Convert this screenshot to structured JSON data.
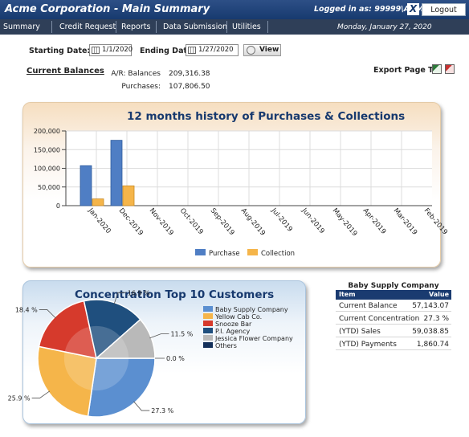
{
  "header": {
    "title": "Acme Corporation - Main Summary",
    "login_text": "Logged in as: 99999\\ADMIN",
    "close_glyph": "X",
    "logout_label": "Logout"
  },
  "menu": {
    "items": [
      "Summary",
      "Credit Request",
      "Reports",
      "Data Submission",
      "Utilities"
    ],
    "date_text": "Monday, January 27, 2020"
  },
  "filters": {
    "starting_label": "Starting Date:",
    "starting_value": "1/1/2020",
    "ending_label": "Ending Date:",
    "ending_value": "1/27/2020",
    "view_label": "View"
  },
  "balances": {
    "title": "Current Balances",
    "ar_label": "A/R: Balances",
    "ar_value": "209,316.38",
    "purchases_label": "Purchases:",
    "purchases_value": "107,806.50"
  },
  "export": {
    "label": "Export Page To:",
    "icons": [
      "excel-icon",
      "pdf-icon"
    ]
  },
  "colors": {
    "purchase": "#4f7ec4",
    "collection": "#f5b54a",
    "header_blue": "#17396e"
  },
  "chart_data": [
    {
      "type": "bar",
      "title": "12 months history of Purchases & Collections",
      "categories": [
        "Jan-2020",
        "Dec-2019",
        "Nov-2019",
        "Oct-2019",
        "Sep-2019",
        "Aug-2019",
        "Jul-2019",
        "Jun-2019",
        "May-2019",
        "Apr-2019",
        "Mar-2019",
        "Feb-2019"
      ],
      "series": [
        {
          "name": "Purchase",
          "values": [
            107000,
            175000,
            0,
            0,
            0,
            0,
            0,
            0,
            0,
            0,
            0,
            0
          ]
        },
        {
          "name": "Collection",
          "values": [
            18000,
            53000,
            0,
            0,
            0,
            0,
            0,
            0,
            0,
            0,
            0,
            0
          ]
        }
      ],
      "ylim": [
        0,
        200000
      ],
      "yticks": [
        "200,000",
        "150,000",
        "100,000",
        "50,000",
        "0"
      ],
      "grid": true,
      "legend": "bottom"
    },
    {
      "type": "pie",
      "title": "Concentration Top 10 Customers",
      "slices": [
        {
          "name": "Baby Supply Company",
          "value": 27.3,
          "label": "27.3 %",
          "color": "#5b8fd0"
        },
        {
          "name": "Yellow Cab Co.",
          "value": 25.9,
          "label": "25.9 %",
          "color": "#f5b54a"
        },
        {
          "name": "Snooze Bar",
          "value": 18.4,
          "label": "18.4 %",
          "color": "#d63a2c"
        },
        {
          "name": "P.I. Agency",
          "value": 16.9,
          "label": "16.9 %",
          "color": "#1f4f7e"
        },
        {
          "name": "Jessica Flower Company",
          "value": 11.5,
          "label": "11.5 %",
          "color": "#b9b9b9"
        },
        {
          "name": "Others",
          "value": 0.0,
          "label": "0.0 %",
          "color": "#14305a"
        }
      ],
      "legend": "right"
    }
  ],
  "customer_table": {
    "title": "Baby Supply Company",
    "header_item": "Item",
    "header_value": "Value",
    "rows": [
      {
        "item": "Current Balance",
        "value": "57,143.07"
      },
      {
        "item": "Current Concentration",
        "value": "27.3 %"
      },
      {
        "item": "(YTD) Sales",
        "value": "59,038.85"
      },
      {
        "item": "(YTD) Payments",
        "value": "1,860.74"
      }
    ]
  }
}
